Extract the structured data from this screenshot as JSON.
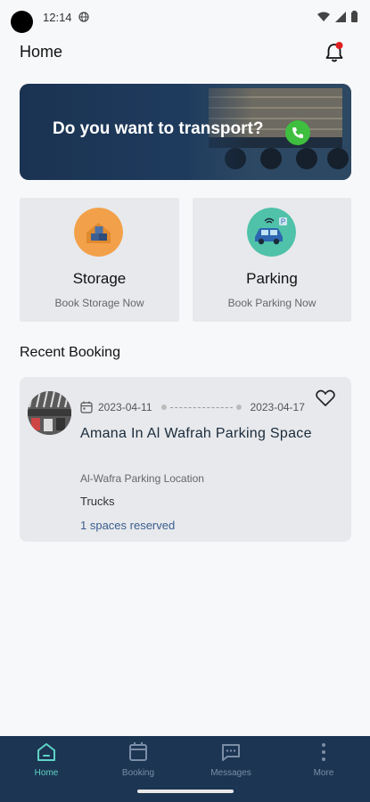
{
  "status": {
    "time": "12:14"
  },
  "header": {
    "title": "Home"
  },
  "banner": {
    "text": "Do you want to transport?"
  },
  "services": [
    {
      "title": "Storage",
      "subtitle": "Book Storage Now"
    },
    {
      "title": "Parking",
      "subtitle": "Book Parking Now"
    }
  ],
  "recent": {
    "title": "Recent Booking",
    "booking": {
      "start_date": "2023-04-11",
      "end_date": "2023-04-17",
      "title": "Amana In Al Wafrah Parking Space",
      "location": "Al-Wafra Parking Location",
      "type": "Trucks",
      "reserved": "1 spaces reserved"
    }
  },
  "nav": {
    "items": [
      {
        "label": "Home",
        "icon": "home-icon",
        "active": true
      },
      {
        "label": "Booking",
        "icon": "calendar-icon",
        "active": false
      },
      {
        "label": "Messages",
        "icon": "message-icon",
        "active": false
      },
      {
        "label": "More",
        "icon": "more-vertical-icon",
        "active": false
      }
    ]
  },
  "colors": {
    "nav_bg": "#1c3553",
    "nav_active": "#5fd3c6",
    "nav_inactive": "#7b8ea6",
    "card_bg": "#e7e9ec",
    "link": "#3b5d8f",
    "notification_dot": "#e02020",
    "call_green": "#3fbf3f"
  }
}
